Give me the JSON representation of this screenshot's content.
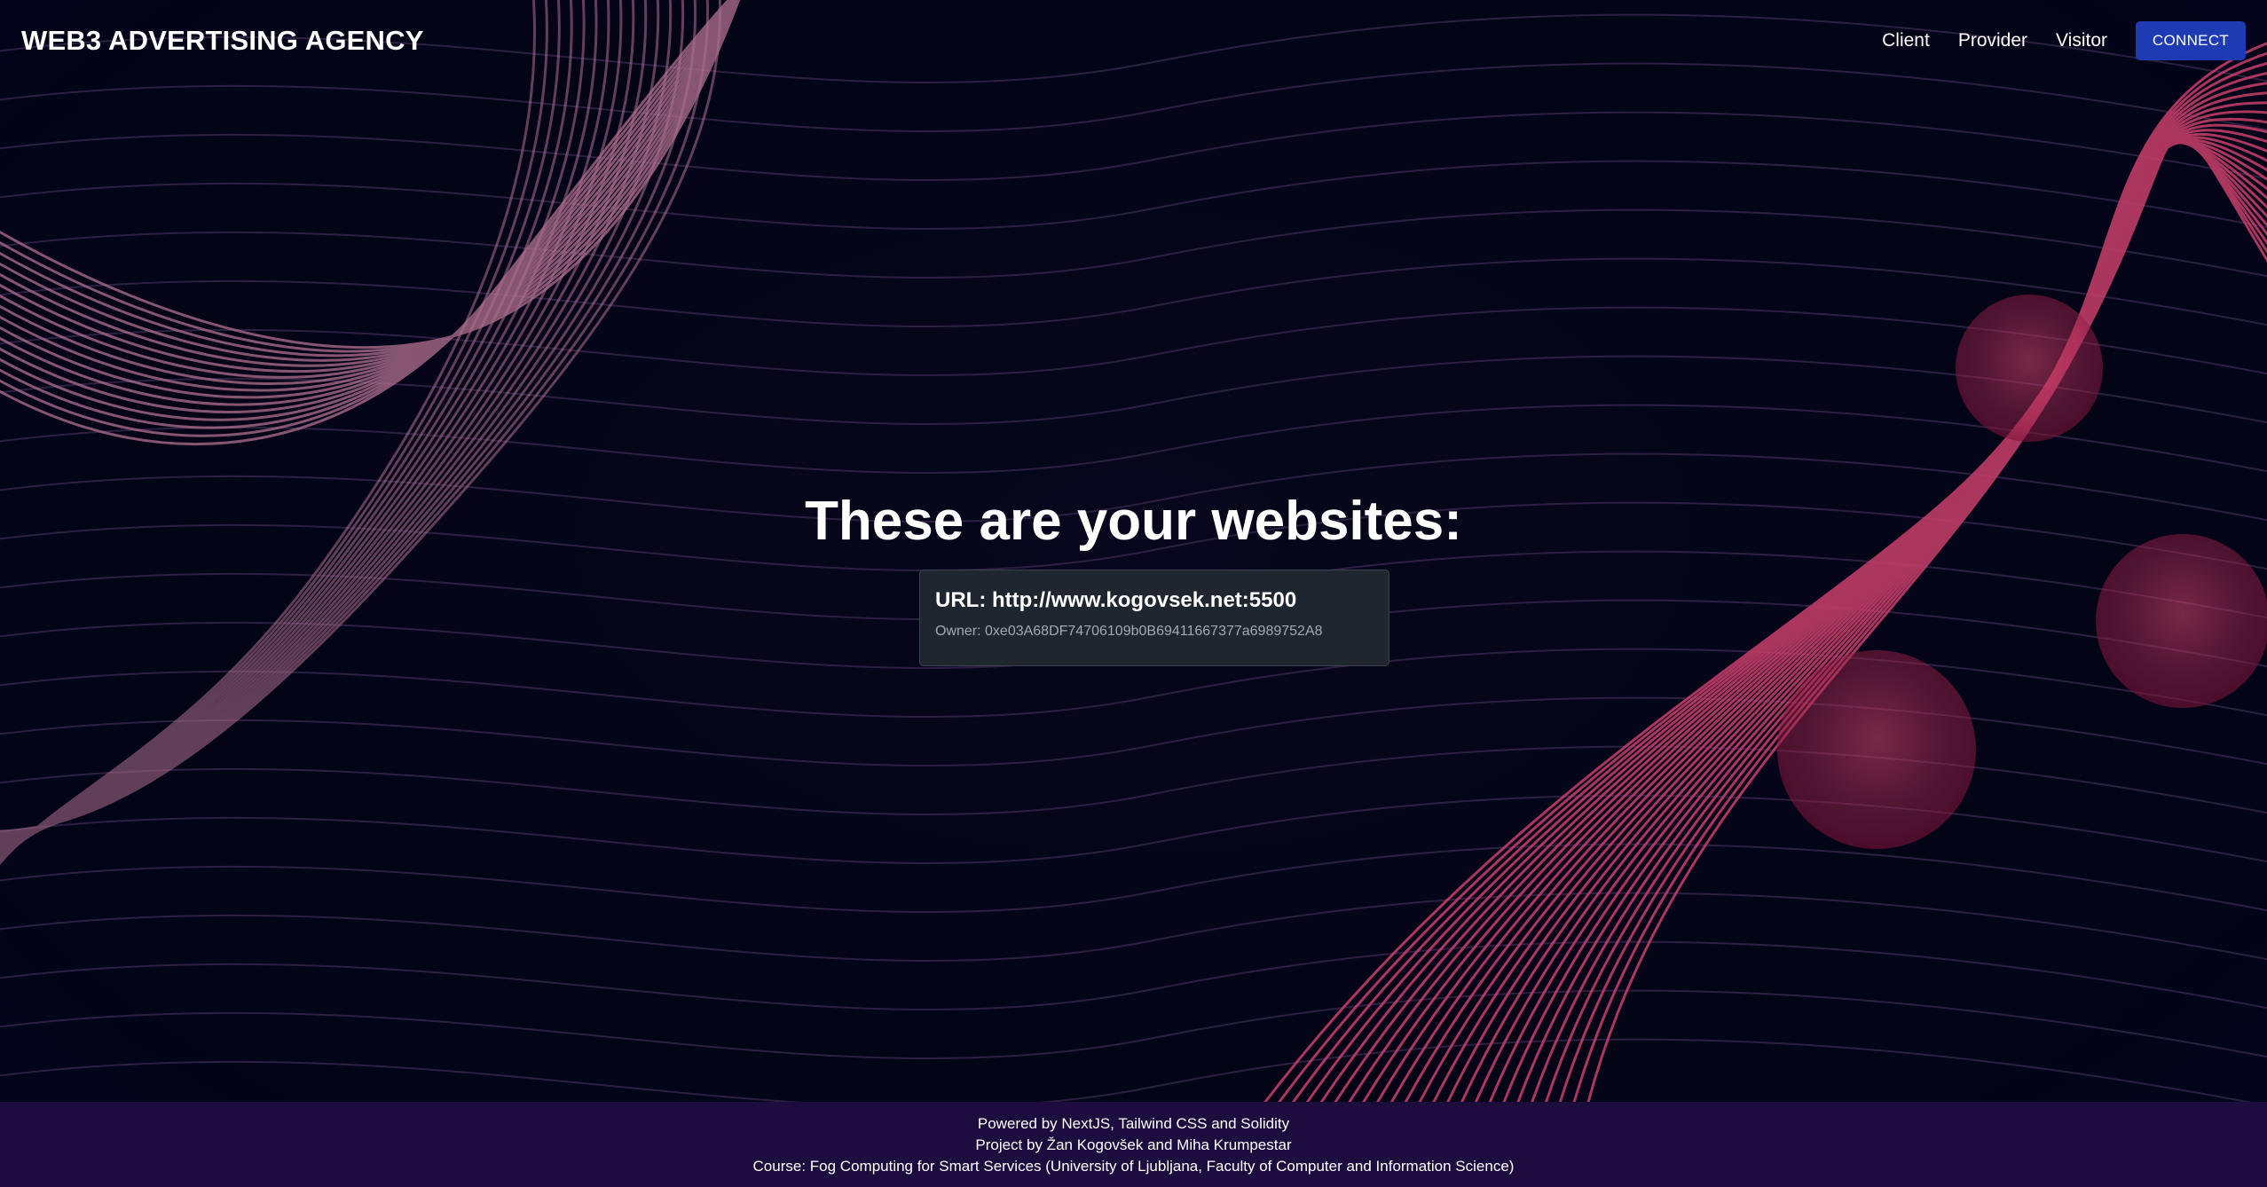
{
  "header": {
    "brand": "WEB3 ADVERTISING AGENCY",
    "nav": [
      "Client",
      "Provider",
      "Visitor"
    ],
    "connect_label": "CONNECT"
  },
  "main": {
    "title": "These are your websites:",
    "websites": [
      {
        "url": "URL: http://www.kogovsek.net:5500",
        "owner": "Owner: 0xe03A68DF74706109b0B69411667377a6989752A8"
      }
    ]
  },
  "footer": {
    "lines": [
      "Powered by NextJS, Tailwind CSS and Solidity",
      "Project by Žan Kogovšek and Miha Krumpestar",
      "Course: Fog Computing for Smart Services (University of Ljubljana, Faculty of Computer and Information Science)"
    ]
  },
  "colors": {
    "background": "#03031a",
    "accent_button": "#1f3bb3",
    "card_bg": "#1f2630",
    "footer_bg": "#1d0c3e",
    "wave_pink": "#c93f6b",
    "wave_mauve": "#b0708f"
  }
}
